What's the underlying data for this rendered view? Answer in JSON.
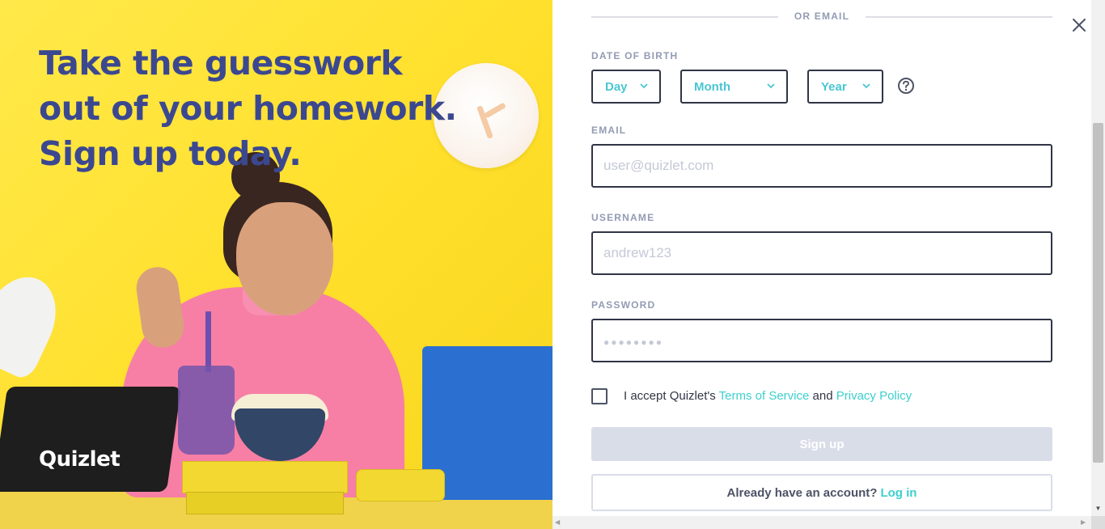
{
  "hero": {
    "headline": "Take the guesswork out of your homework. Sign up today.",
    "logo": "Quizlet",
    "background_color": "#ffe12a",
    "headline_color": "#3b4890"
  },
  "form": {
    "divider_label": "OR EMAIL",
    "close_icon": "close-icon",
    "dob": {
      "label": "DATE OF BIRTH",
      "day": "Day",
      "month": "Month",
      "year": "Year",
      "help_icon": "question-circle-icon"
    },
    "email": {
      "label": "EMAIL",
      "placeholder": "user@quizlet.com"
    },
    "username": {
      "label": "USERNAME",
      "placeholder": "andrew123"
    },
    "password": {
      "label": "PASSWORD",
      "placeholder": "●●●●●●●●"
    },
    "terms": {
      "prefix": "I accept Quizlet's",
      "tos_link": "Terms of Service",
      "and": "and",
      "privacy_link": "Privacy Policy",
      "checked": false
    },
    "signup_button": "Sign up",
    "login_prompt": "Already have an account?",
    "login_link": "Log in",
    "accent_color": "#3ccfcf",
    "border_color": "#303545"
  }
}
